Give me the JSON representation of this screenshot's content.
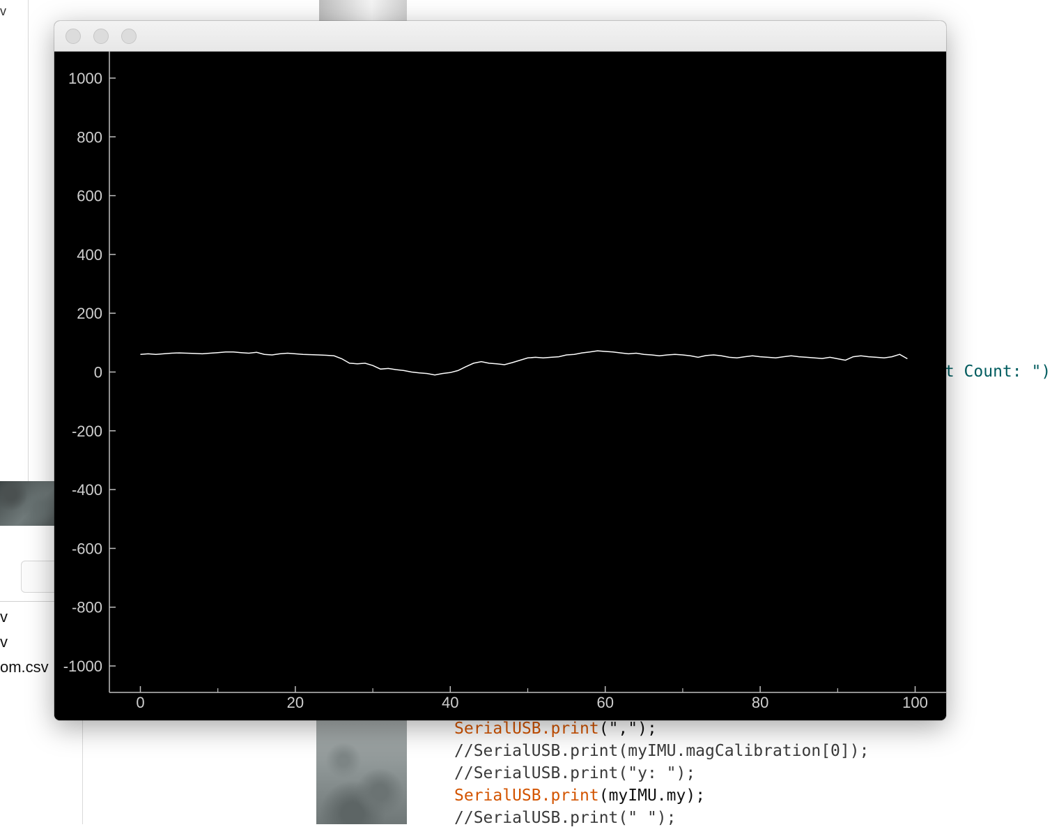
{
  "background": {
    "corner_glyph": "v",
    "files": [
      "v",
      "v",
      "om.csv"
    ],
    "code_right": "nt Count: \")",
    "code_lines": [
      {
        "fn": "SerialUSB.print",
        "rest": "(\",\");"
      },
      {
        "plain": "//SerialUSB.print(myIMU.magCalibration[0]);"
      },
      {
        "plain": "//SerialUSB.print(\"y: \");"
      },
      {
        "fn": "SerialUSB.print",
        "rest": "(myIMU.my);"
      },
      {
        "plain": "//SerialUSB.print(\" \");"
      }
    ]
  },
  "window": {
    "traffic_lights": [
      "close",
      "minimize",
      "zoom"
    ]
  },
  "chart_data": {
    "type": "line",
    "xlim": [
      -4,
      104
    ],
    "ylim": [
      -1090,
      1090
    ],
    "x_ticks": [
      0,
      20,
      40,
      60,
      80,
      100
    ],
    "y_ticks": [
      1000,
      800,
      600,
      400,
      200,
      0,
      -200,
      -400,
      -600,
      -800,
      -1000
    ],
    "grid": false,
    "colors": {
      "background": "#000000",
      "line": "#ffffff",
      "axis": "#bfbfbf",
      "text": "#cfcfcf"
    },
    "series": [
      {
        "x": [
          0,
          1,
          2,
          3,
          4,
          5,
          6,
          7,
          8,
          9,
          10,
          11,
          12,
          13,
          14,
          15,
          16,
          17,
          18,
          19,
          20,
          21,
          22,
          23,
          24,
          25,
          26,
          27,
          28,
          29,
          30,
          31,
          32,
          33,
          34,
          35,
          36,
          37,
          38,
          39,
          40,
          41,
          42,
          43,
          44,
          45,
          46,
          47,
          48,
          49,
          50,
          51,
          52,
          53,
          54,
          55,
          56,
          57,
          58,
          59,
          60,
          61,
          62,
          63,
          64,
          65,
          66,
          67,
          68,
          69,
          70,
          71,
          72,
          73,
          74,
          75,
          76,
          77,
          78,
          79,
          80,
          81,
          82,
          83,
          84,
          85,
          86,
          87,
          88,
          89,
          90,
          91,
          92,
          93,
          94,
          95,
          96,
          97,
          98,
          99
        ],
        "y": [
          60,
          62,
          60,
          62,
          64,
          65,
          64,
          63,
          62,
          64,
          66,
          68,
          68,
          66,
          64,
          67,
          60,
          58,
          62,
          64,
          62,
          60,
          59,
          58,
          57,
          55,
          45,
          30,
          28,
          30,
          22,
          10,
          12,
          8,
          5,
          0,
          -3,
          -5,
          -10,
          -5,
          -2,
          5,
          18,
          30,
          35,
          30,
          28,
          25,
          32,
          40,
          48,
          50,
          48,
          50,
          52,
          58,
          60,
          65,
          68,
          72,
          70,
          68,
          65,
          62,
          64,
          60,
          58,
          55,
          58,
          60,
          58,
          55,
          50,
          56,
          58,
          55,
          50,
          48,
          52,
          55,
          52,
          50,
          48,
          52,
          55,
          52,
          50,
          48,
          46,
          50,
          45,
          40,
          52,
          55,
          52,
          50,
          48,
          52,
          60,
          45
        ]
      }
    ]
  }
}
